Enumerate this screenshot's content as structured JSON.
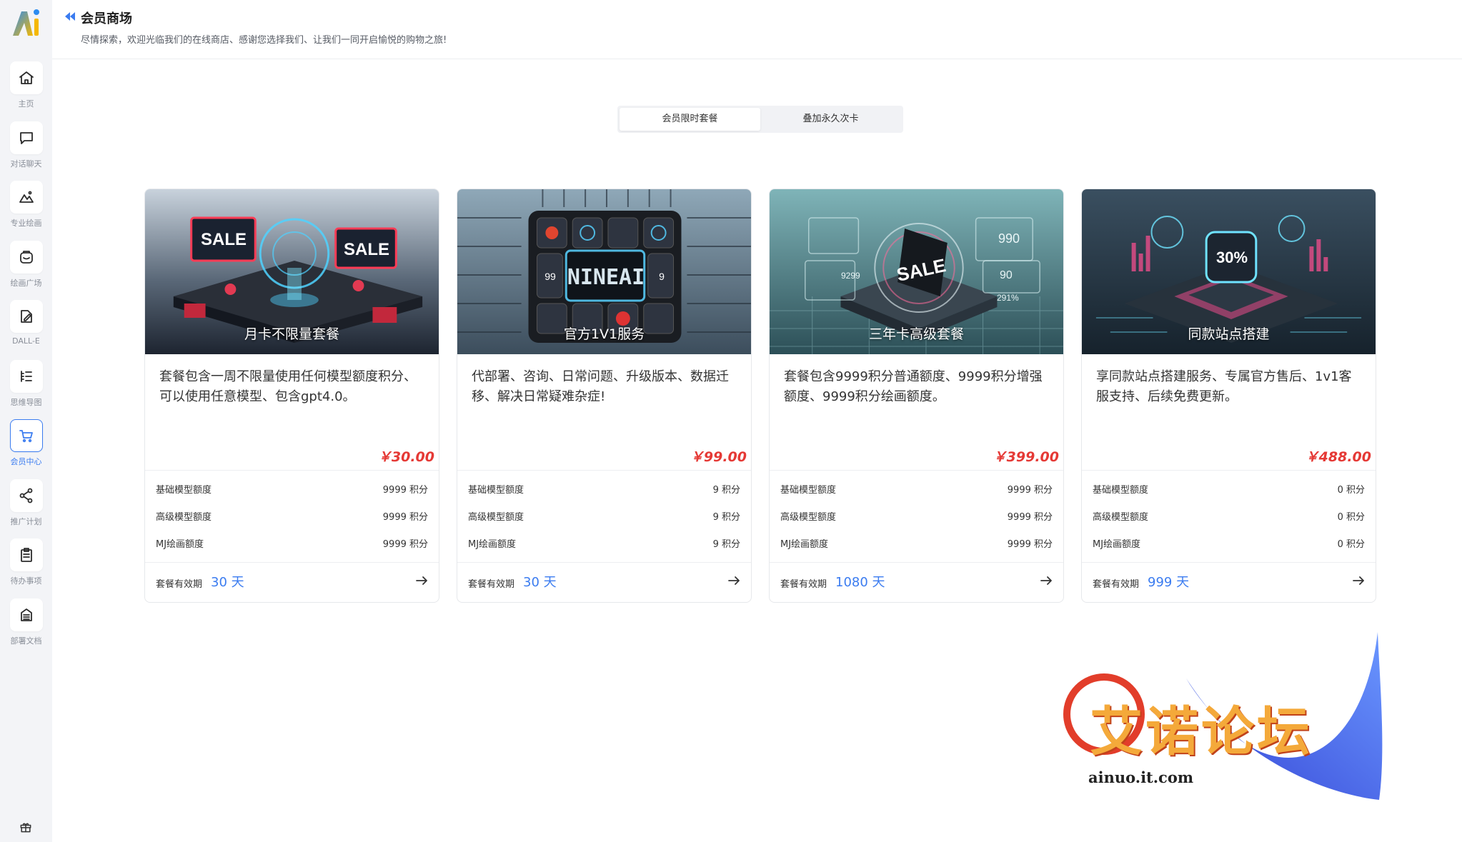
{
  "sidebar": {
    "items": [
      {
        "label": "主页",
        "icon": "home-icon"
      },
      {
        "label": "对话聊天",
        "icon": "chat-icon"
      },
      {
        "label": "专业绘画",
        "icon": "image-icon"
      },
      {
        "label": "绘画广场",
        "icon": "gallery-icon"
      },
      {
        "label": "DALL-E",
        "icon": "edit-icon"
      },
      {
        "label": "思维导图",
        "icon": "mindmap-icon"
      },
      {
        "label": "会员中心",
        "icon": "cart-icon",
        "active": true
      },
      {
        "label": "推广计划",
        "icon": "share-icon"
      },
      {
        "label": "待办事项",
        "icon": "clipboard-icon"
      },
      {
        "label": "部署文档",
        "icon": "document-icon"
      }
    ],
    "accent_color": "#3b7cf0"
  },
  "header": {
    "title": "会员商场",
    "subtitle": "尽情探索，欢迎光临我们的在线商店、感谢您选择我们、让我们一同开启愉悦的购物之旅!"
  },
  "tabs": [
    {
      "label": "会员限时套餐",
      "active": true
    },
    {
      "label": "叠加永久次卡",
      "active": false
    }
  ],
  "cards": [
    {
      "image_title": "月卡不限量套餐",
      "description": "套餐包含一周不限量使用任何模型额度积分、可以使用任意模型、包含gpt4.0。",
      "price": "￥30.00",
      "quotas": [
        {
          "name": "基础模型额度",
          "value": "9999 积分"
        },
        {
          "name": "高级模型额度",
          "value": "9999 积分"
        },
        {
          "name": "MJ绘画额度",
          "value": "9999 积分"
        }
      ],
      "validity_label": "套餐有效期",
      "validity": "30 天"
    },
    {
      "image_title": "官方1V1服务",
      "description": "代部署、咨询、日常问题、升级版本、数据迁移、解决日常疑难杂症!",
      "price": "￥99.00",
      "quotas": [
        {
          "name": "基础模型额度",
          "value": "9 积分"
        },
        {
          "name": "高级模型额度",
          "value": "9 积分"
        },
        {
          "name": "MJ绘画额度",
          "value": "9 积分"
        }
      ],
      "validity_label": "套餐有效期",
      "validity": "30 天"
    },
    {
      "image_title": "三年卡高级套餐",
      "description": "套餐包含9999积分普通额度、9999积分增强额度、9999积分绘画额度。",
      "price": "￥399.00",
      "quotas": [
        {
          "name": "基础模型额度",
          "value": "9999 积分"
        },
        {
          "name": "高级模型额度",
          "value": "9999 积分"
        },
        {
          "name": "MJ绘画额度",
          "value": "9999 积分"
        }
      ],
      "validity_label": "套餐有效期",
      "validity": "1080 天"
    },
    {
      "image_title": "同款站点搭建",
      "description": "享同款站点搭建服务、专属官方售后、1v1客服支持、后续免费更新。",
      "price": "￥488.00",
      "quotas": [
        {
          "name": "基础模型额度",
          "value": "0 积分"
        },
        {
          "name": "高级模型额度",
          "value": "0 积分"
        },
        {
          "name": "MJ绘画额度",
          "value": "0 积分"
        }
      ],
      "validity_label": "套餐有效期",
      "validity": "999 天"
    }
  ],
  "images": {
    "card1_badges": [
      "SALE",
      "SALE"
    ],
    "card2_badge": "NINEAI",
    "card2_tiles": [
      "99",
      "9"
    ],
    "card3_badge": "SALE",
    "card3_numbers": [
      "990",
      "90",
      "9299",
      "291%"
    ],
    "card4_badge": "30%"
  },
  "watermark": {
    "text": "艾诺论坛",
    "url": "ainuo.it.com"
  },
  "colors": {
    "price": "#e53935",
    "validity": "#3b7cf0"
  }
}
